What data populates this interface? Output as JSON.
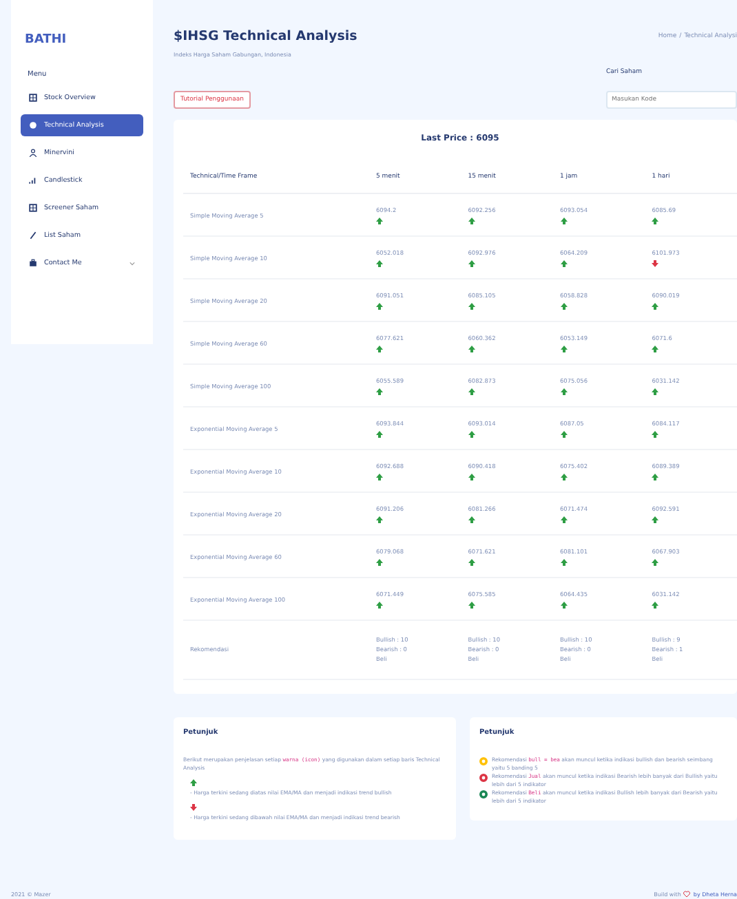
{
  "sidebar": {
    "logo": "BATHI",
    "menu_title": "Menu",
    "items": [
      {
        "label": "Stock Overview",
        "kind": "grid",
        "selected": false,
        "expandable": false
      },
      {
        "label": "Technical Analysis",
        "kind": "circle",
        "selected": true,
        "expandable": false
      },
      {
        "label": "Minervini",
        "kind": "person",
        "selected": false,
        "expandable": false
      },
      {
        "label": "Candlestick",
        "kind": "chart",
        "selected": false,
        "expandable": false
      },
      {
        "label": "Screener Saham",
        "kind": "grid",
        "selected": false,
        "expandable": false
      },
      {
        "label": "List Saham",
        "kind": "pen",
        "selected": false,
        "expandable": false
      },
      {
        "label": "Contact Me",
        "kind": "briefcase",
        "selected": false,
        "expandable": true
      }
    ]
  },
  "header": {
    "title": "$IHSG Technical Analysis",
    "subtitle": "Indeks Harga Saham Gabungan, Indonesia",
    "breadcrumb": [
      "Home",
      "/",
      "Technical Analysi"
    ]
  },
  "tutorial_button": "Tutorial Penggunaan",
  "search": {
    "label": "Cari Saham",
    "placeholder": "Masukan Kode"
  },
  "table": {
    "last_price": "Last Price : 6095",
    "columns": [
      "Technical/Time Frame",
      "5 menit",
      "15 menit",
      "1 jam",
      "1 hari"
    ],
    "rows": [
      {
        "cells": [
          {
            "value": "Simple Moving Average 5"
          },
          {
            "value": "6094.2",
            "rising": true
          },
          {
            "value": "6092.256",
            "rising": true
          },
          {
            "value": "6093.054",
            "rising": true
          },
          {
            "value": "6085.69",
            "rising": true
          }
        ]
      },
      {
        "cells": [
          {
            "value": "Simple Moving Average 10"
          },
          {
            "value": "6052.018",
            "rising": true
          },
          {
            "value": "6092.976",
            "rising": true
          },
          {
            "value": "6064.209",
            "rising": true
          },
          {
            "value": "6101.973",
            "rising": false
          }
        ]
      },
      {
        "cells": [
          {
            "value": "Simple Moving Average 20"
          },
          {
            "value": "6091.051",
            "rising": true
          },
          {
            "value": "6085.105",
            "rising": true
          },
          {
            "value": "6058.828",
            "rising": true
          },
          {
            "value": "6090.019",
            "rising": true
          }
        ]
      },
      {
        "cells": [
          {
            "value": "Simple Moving Average 60"
          },
          {
            "value": "6077.621",
            "rising": true
          },
          {
            "value": "6060.362",
            "rising": true
          },
          {
            "value": "6053.149",
            "rising": true
          },
          {
            "value": "6071.6",
            "rising": true
          }
        ]
      },
      {
        "cells": [
          {
            "value": "Simple Moving Average 100"
          },
          {
            "value": "6055.589",
            "rising": true
          },
          {
            "value": "6082.873",
            "rising": true
          },
          {
            "value": "6075.056",
            "rising": true
          },
          {
            "value": "6031.142",
            "rising": true
          }
        ]
      },
      {
        "cells": [
          {
            "value": "Exponential Moving Average 5"
          },
          {
            "value": "6093.844",
            "rising": true
          },
          {
            "value": "6093.014",
            "rising": true
          },
          {
            "value": "6087.05",
            "rising": true
          },
          {
            "value": "6084.117",
            "rising": true
          }
        ]
      },
      {
        "cells": [
          {
            "value": "Exponential Moving Average 10"
          },
          {
            "value": "6092.688",
            "rising": true
          },
          {
            "value": "6090.418",
            "rising": true
          },
          {
            "value": "6075.402",
            "rising": true
          },
          {
            "value": "6089.389",
            "rising": true
          }
        ]
      },
      {
        "cells": [
          {
            "value": "Exponential Moving Average 20"
          },
          {
            "value": "6091.206",
            "rising": true
          },
          {
            "value": "6081.266",
            "rising": true
          },
          {
            "value": "6071.474",
            "rising": true
          },
          {
            "value": "6092.591",
            "rising": true
          }
        ]
      },
      {
        "cells": [
          {
            "value": "Exponential Moving Average 60"
          },
          {
            "value": "6079.068",
            "rising": true
          },
          {
            "value": "6071.621",
            "rising": true
          },
          {
            "value": "6081.101",
            "rising": true
          },
          {
            "value": "6067.903",
            "rising": true
          }
        ]
      },
      {
        "cells": [
          {
            "value": "Exponential Moving Average 100"
          },
          {
            "value": "6071.449",
            "rising": true
          },
          {
            "value": "6075.585",
            "rising": true
          },
          {
            "value": "6064.435",
            "rising": true
          },
          {
            "value": "6031.142",
            "rising": true
          }
        ]
      },
      {
        "cells": [
          {
            "lines": [
              "Rekomendasi"
            ]
          },
          {
            "lines": [
              "Bullish : 10",
              "Bearish : 0",
              "Beli"
            ]
          },
          {
            "lines": [
              "Bullish : 10",
              "Bearish : 0",
              "Beli"
            ]
          },
          {
            "lines": [
              "Bullish : 10",
              "Bearish : 0",
              "Beli"
            ]
          },
          {
            "lines": [
              "Bullish : 9",
              "Bearish : 1",
              "Beli"
            ]
          }
        ]
      }
    ]
  },
  "guide_left": {
    "title": "Petunjuk",
    "intro_before": "Berikut merupakan penjelasan setiap ",
    "intro_code": "warna (icon)",
    "intro_after": " yang digunakan dalam setiap baris Technical Analysis",
    "items": [
      {
        "rising": true,
        "text": "- Harga terkini sedang diatas nilai EMA/MA dan menjadi indikasi trend bullish"
      },
      {
        "rising": false,
        "text": "- Harga terkini sedang dibawah nilai EMA/MA dan menjadi indikasi trend bearish"
      }
    ]
  },
  "guide_right": {
    "title": "Petunjuk",
    "items": [
      {
        "color": "#ffc107",
        "before": "Rekomendasi ",
        "code": "bull = bea",
        "after": " akan muncul ketika indikasi bullish dan bearish seimbang yaitu 5 banding 5"
      },
      {
        "color": "#dc3545",
        "before": "Rekomendasi ",
        "code": "Jual",
        "after": " akan muncul ketika indikasi Bearish lebih banyak dari Bullish yaitu lebih dari 5 indikator"
      },
      {
        "color": "#198754",
        "before": "Rekomendasi ",
        "code": "Beli",
        "after": " akan muncul ketika indikasi Bullish lebih banyak dari Bearish yaitu lebih dari 5 indikator"
      }
    ]
  },
  "footer": {
    "left": "2021 © Mazer",
    "right_before": "Build with",
    "right_after": "by Dheta Herna"
  }
}
